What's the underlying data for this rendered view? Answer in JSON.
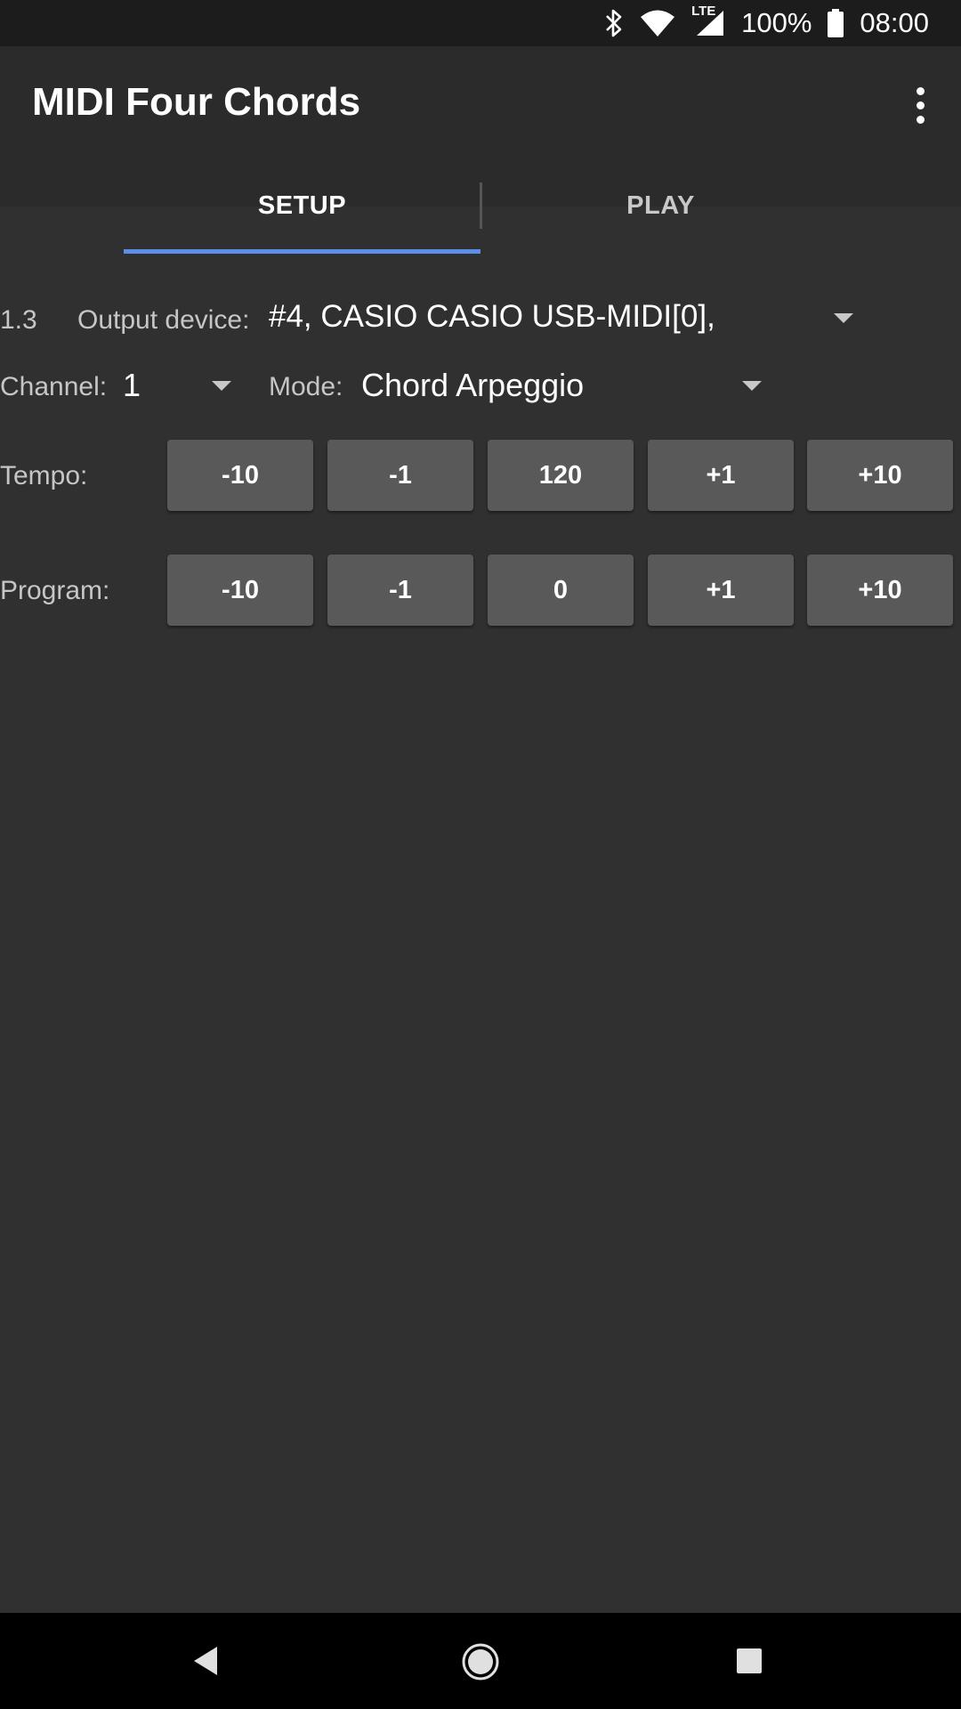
{
  "status_bar": {
    "network_label": "LTE",
    "battery": "100%",
    "time": "08:00",
    "icons": [
      "bluetooth-icon",
      "wifi-icon",
      "cell-signal-icon",
      "battery-icon"
    ]
  },
  "app_bar": {
    "title": "MIDI Four Chords",
    "menu_icon": "more-vert-icon"
  },
  "tabs": [
    {
      "label": "SETUP",
      "selected": true
    },
    {
      "label": "PLAY",
      "selected": false
    }
  ],
  "setup": {
    "version": "1.3",
    "output_device_label": "Output device:",
    "output_device_value": "#4, CASIO CASIO USB-MIDI[0],",
    "channel_label": "Channel:",
    "channel_value": "1",
    "mode_label": "Mode:",
    "mode_value": "Chord Arpeggio",
    "tempo": {
      "label": "Tempo:",
      "buttons": [
        "-10",
        "-1",
        "120",
        "+1",
        "+10"
      ]
    },
    "program": {
      "label": "Program:",
      "buttons": [
        "-10",
        "-1",
        "0",
        "+1",
        "+10"
      ]
    }
  },
  "colors": {
    "background": "#303030",
    "app_bar": "#2b2b2b",
    "accent": "#5b8ee6",
    "button": "#595959"
  },
  "nav_bar": {
    "icons": [
      "back-icon",
      "home-icon",
      "recents-icon"
    ]
  }
}
